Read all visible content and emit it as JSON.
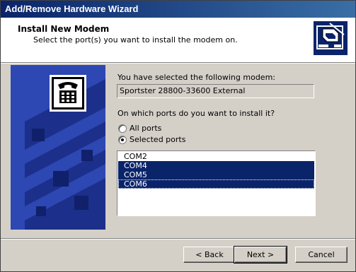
{
  "window": {
    "title": "Add/Remove Hardware Wizard"
  },
  "header": {
    "title": "Install New Modem",
    "subtitle": "Select the port(s) you want to install the modem on."
  },
  "body": {
    "selected_modem_label": "You have selected the following modem:",
    "selected_modem_value": "Sportster 28800-33600 External",
    "question": "On which ports do you want to install it?",
    "radio_all_label": "All ports",
    "radio_selected_label": "Selected ports",
    "selected_radio": "Selected ports",
    "ports": [
      {
        "name": "COM2",
        "selected": false
      },
      {
        "name": "COM4",
        "selected": true
      },
      {
        "name": "COM5",
        "selected": true
      },
      {
        "name": "COM6",
        "selected": true
      }
    ]
  },
  "buttons": {
    "back": "< Back",
    "next": "Next >",
    "cancel": "Cancel"
  },
  "icons": [
    "hardware-wizard-icon",
    "telephone-icon"
  ],
  "colors": {
    "titlebar_start": "#0a246a",
    "titlebar_end": "#3a6ea5",
    "selection": "#0a246a",
    "side_panel": "#1c2f8a"
  }
}
